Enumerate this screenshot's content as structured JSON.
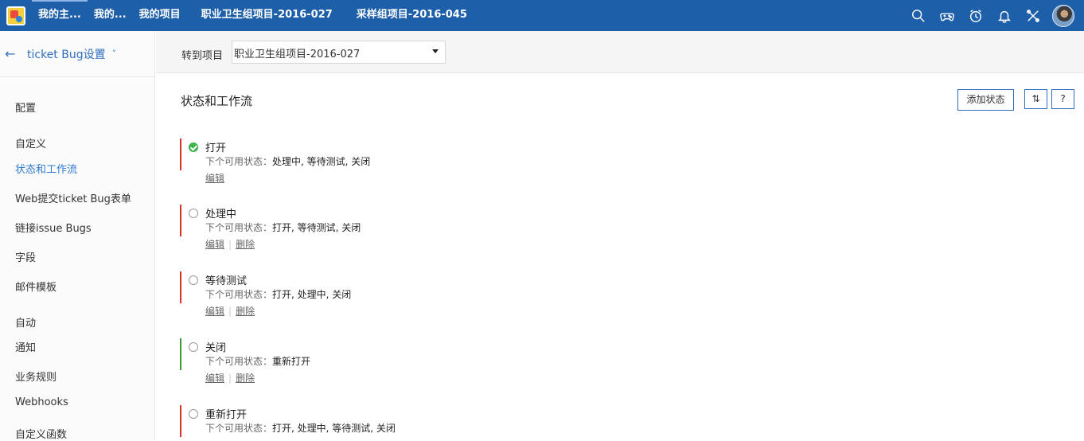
{
  "topnav": {
    "items": [
      "我的主...",
      "我的...",
      "我的项目"
    ],
    "projects": [
      "职业卫生组项目-2016-027",
      "采样组项目-2016-045"
    ],
    "icons": [
      "search-icon",
      "gamepad-icon",
      "alarm-clock-icon",
      "bell-icon",
      "tools-icon",
      "user-avatar"
    ]
  },
  "sidebar": {
    "title": "ticket Bug设置",
    "back": "←",
    "chevron": "˅",
    "config": "配置",
    "section_custom": "自定义",
    "custom_links": [
      "状态和工作流",
      "Web提交ticket Bug表单",
      "链接issue Bugs",
      "字段",
      "邮件模板"
    ],
    "section_auto": "自动",
    "auto_links": [
      "通知",
      "业务规则",
      "Webhooks",
      "自定义函数"
    ]
  },
  "subheader": {
    "goto_label": "转到项目",
    "goto_value": "职业卫生组项目-2016-027"
  },
  "main": {
    "title": "状态和工作流",
    "add_button": "添加状态",
    "sort_button": "⇅",
    "help_button": "?",
    "next_label": "下个可用状态：",
    "edit_label": "编辑",
    "delete_label": "删除",
    "separator": "|",
    "statuses": [
      {
        "name": "打开",
        "next": "处理中, 等待测试, 关闭",
        "bar_color": "#d9322b",
        "checked": true
      },
      {
        "name": "处理中",
        "next": "打开, 等待测试, 关闭",
        "bar_color": "#d9322b",
        "checked": false
      },
      {
        "name": "等待测试",
        "next": "打开, 处理中, 关闭",
        "bar_color": "#d9322b",
        "checked": false
      },
      {
        "name": "关闭",
        "next": "重新打开",
        "bar_color": "#3a9a3a",
        "checked": false
      },
      {
        "name": "重新打开",
        "next": "打开, 处理中, 等待测试, 关闭",
        "bar_color": "#d9322b",
        "checked": false
      }
    ]
  },
  "colors": {
    "topbar": "#1d5fa8",
    "accent": "#2f7ad0",
    "check_green": "#3eb34a"
  }
}
